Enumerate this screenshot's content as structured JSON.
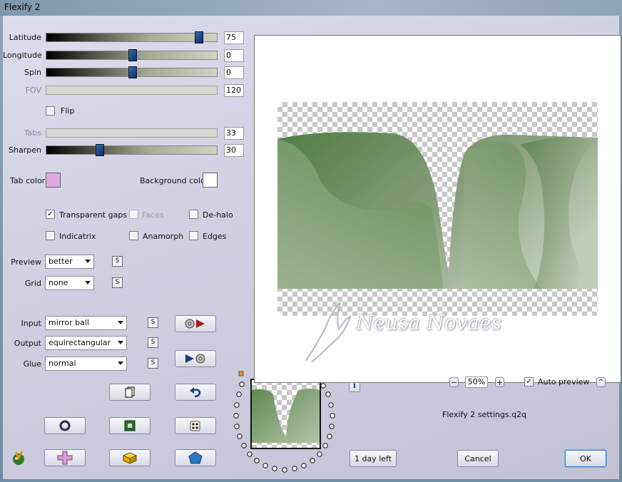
{
  "window": {
    "title": "Flexify 2"
  },
  "sliders": {
    "latitude": {
      "label": "Latitude",
      "value": "75",
      "fraction": 0.89
    },
    "longitude": {
      "label": "Longitude",
      "value": "0",
      "fraction": 0.5
    },
    "spin": {
      "label": "Spin",
      "value": "0",
      "fraction": 0.5
    },
    "fov": {
      "label": "FOV",
      "value": "120"
    },
    "tabs": {
      "label": "Tabs",
      "value": "33"
    },
    "sharpen": {
      "label": "Sharpen",
      "value": "30",
      "fraction": 0.31
    }
  },
  "checkboxes": {
    "flip": {
      "label": "Flip",
      "checked": false
    },
    "transparent_gaps": {
      "label": "Transparent gaps",
      "checked": true,
      "mark": "✓"
    },
    "faces": {
      "label": "Faces",
      "checked": false
    },
    "de_halo": {
      "label": "De-halo",
      "checked": false
    },
    "indicatrix": {
      "label": "Indicatrix",
      "checked": false
    },
    "anamorph": {
      "label": "Anamorph",
      "checked": false
    },
    "edges": {
      "label": "Edges",
      "checked": false
    },
    "auto_preview": {
      "label": "Auto preview",
      "checked": true,
      "mark": "✓"
    }
  },
  "colors": {
    "tab_color_label": "Tab color",
    "tab_color": "#e0a8e0",
    "background_color_label": "Background color",
    "background_color": "#ffffff"
  },
  "selects": {
    "preview": {
      "label": "Preview",
      "value": "better"
    },
    "grid": {
      "label": "Grid",
      "value": "none"
    },
    "input": {
      "label": "Input",
      "value": "mirror ball"
    },
    "output": {
      "label": "Output",
      "value": "equirectangular"
    },
    "glue": {
      "label": "Glue",
      "value": "normal"
    }
  },
  "s_button_label": "S",
  "zoom": {
    "value": "50%",
    "minus": "−",
    "plus": "+"
  },
  "settings_file": "Flexify 2 settings.q2q",
  "info_label": "i",
  "up_label": "^",
  "watermark": "Neusa Novaes",
  "buttons": {
    "day_left": "1 day left",
    "cancel": "Cancel",
    "ok": "OK"
  }
}
